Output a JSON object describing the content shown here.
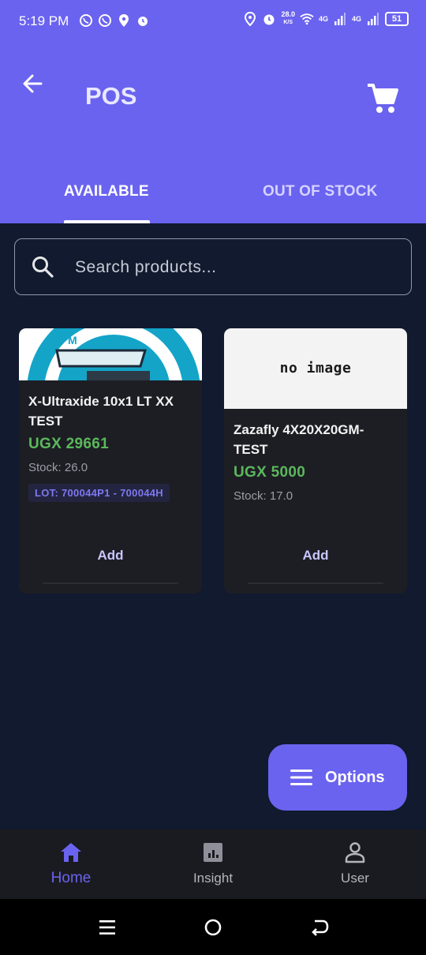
{
  "status_bar": {
    "time": "5:19 PM",
    "net_speed_value": "28.0",
    "net_speed_unit": "K/S",
    "signal_1": "4G",
    "signal_2": "4G",
    "battery": "51"
  },
  "header": {
    "title": "POS",
    "back_icon": "arrow-left-icon",
    "cart_icon": "shopping-cart-icon",
    "color": "#6a63ef"
  },
  "tabs": [
    {
      "label": "AVAILABLE",
      "selected": true
    },
    {
      "label": "OUT OF STOCK",
      "selected": false
    }
  ],
  "search": {
    "placeholder": "Search products...",
    "value": ""
  },
  "products": [
    {
      "name": "X-Ultraxide 10x1 LT XX TEST",
      "price": "UGX 29661",
      "stock": "Stock: 26.0",
      "lot": "LOT: 700044P1 - 700044H",
      "image": "product-photo",
      "add_label": "Add"
    },
    {
      "name": "Zazafly 4X20X20GM-TEST",
      "price": "UGX 5000",
      "stock": "Stock: 17.0",
      "image_text": "no image",
      "add_label": "Add"
    }
  ],
  "fab": {
    "label": "Options",
    "icon": "menu-icon"
  },
  "bottom_nav": [
    {
      "label": "Home",
      "icon": "home-icon",
      "selected": true
    },
    {
      "label": "Insight",
      "icon": "bar-chart-icon",
      "selected": false
    },
    {
      "label": "User",
      "icon": "user-icon",
      "selected": false
    }
  ],
  "colors": {
    "accent": "#6a63ef",
    "background": "#111a2e",
    "card": "#1d1e24",
    "price": "#5cb85c"
  }
}
